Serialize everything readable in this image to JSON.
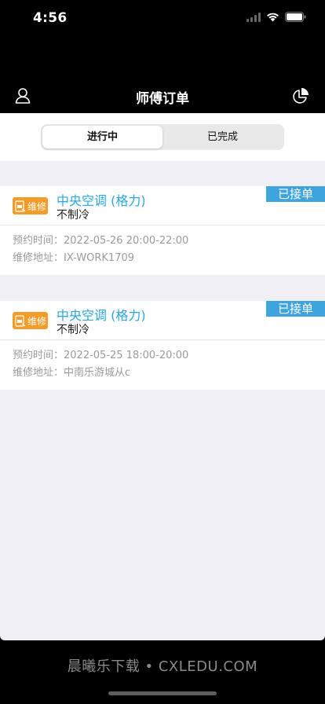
{
  "status_bar": {
    "time": "4:56"
  },
  "nav": {
    "title": "师傅订单"
  },
  "segments": [
    {
      "label": "进行中",
      "active": true
    },
    {
      "label": "已完成",
      "active": false
    }
  ],
  "orders": [
    {
      "type_label": "维修",
      "item_name": "中央空调 (格力)",
      "issue": "不制冷",
      "status": "已接单",
      "time_label": "预约时间：",
      "time_value": "2022-05-26 20:00-22:00",
      "address_label": "维修地址：",
      "address_value": "IX-WORK1709"
    },
    {
      "type_label": "维修",
      "item_name": "中央空调 (格力)",
      "issue": "不制冷",
      "status": "已接单",
      "time_label": "预约时间：",
      "time_value": "2022-05-25 18:00-20:00",
      "address_label": "维修地址：",
      "address_value": "中南乐游城从c"
    }
  ],
  "watermark": "晨曦乐下载 • CXLEDU.COM",
  "colors": {
    "accent": "#2aa5e0",
    "status_tag": "#3ea4dd",
    "badge": "#f39c27",
    "background": "#f0eff4"
  }
}
